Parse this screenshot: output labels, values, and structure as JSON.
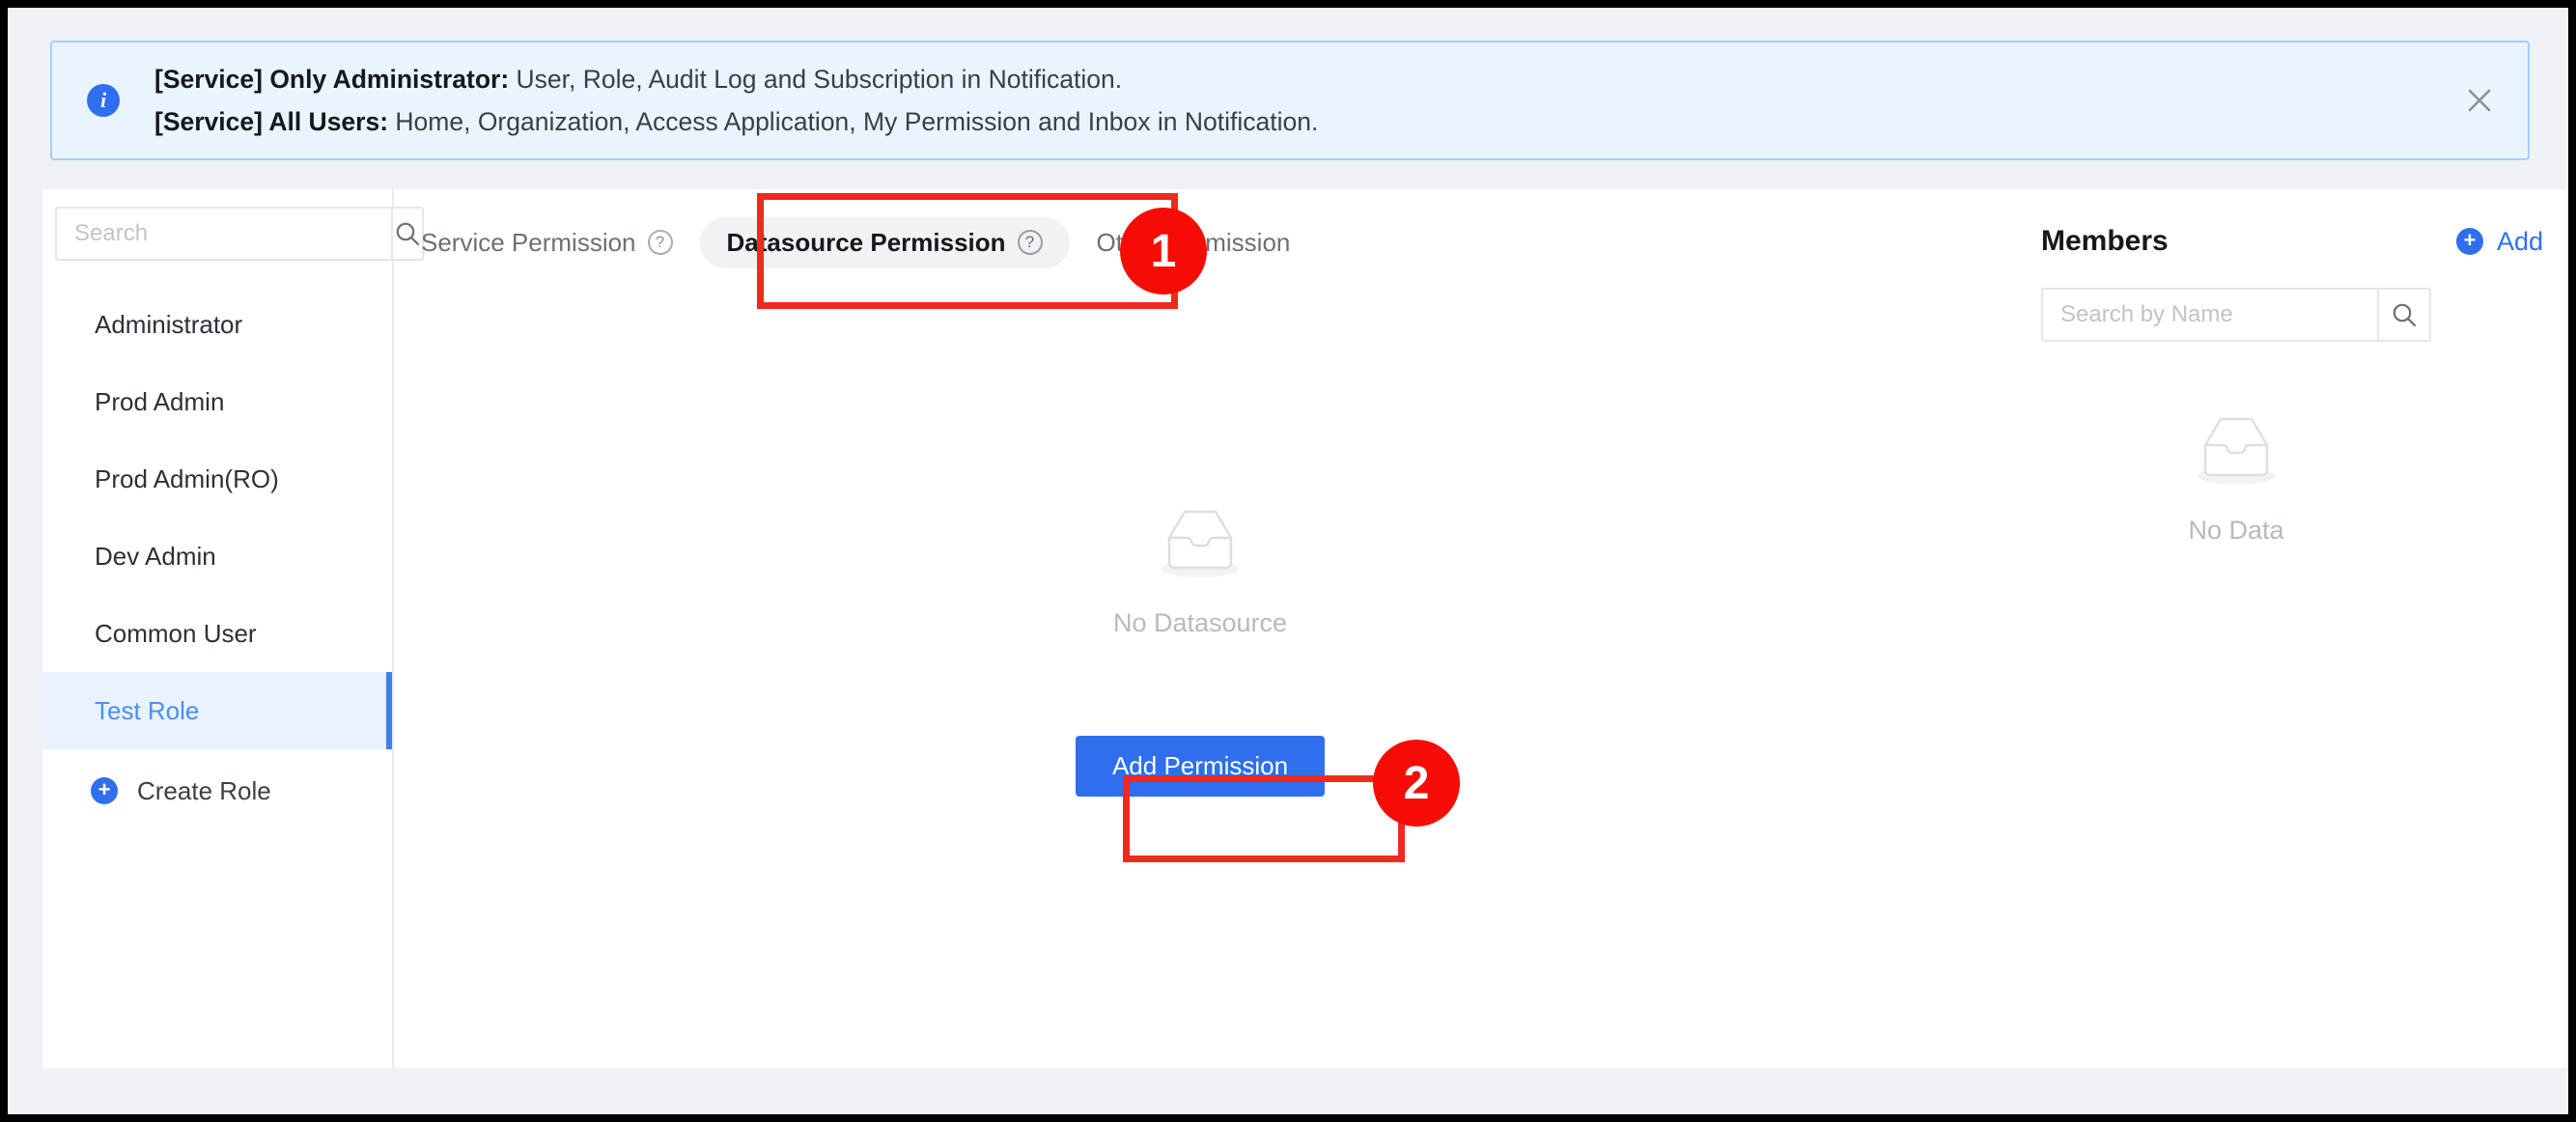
{
  "banner": {
    "icon": "info-icon",
    "line1_lead": "[Service] Only Administrator:",
    "line1_rest": " User, Role, Audit Log and Subscription in Notification.",
    "line2_lead": "[Service] All Users:",
    "line2_rest": " Home, Organization, Access Application, My Permission and Inbox in Notification.",
    "close_icon": "close-icon"
  },
  "sidebar": {
    "search": {
      "value": "",
      "placeholder": "Search",
      "icon": "search-icon"
    },
    "items": [
      {
        "label": "Administrator",
        "active": false
      },
      {
        "label": "Prod Admin",
        "active": false
      },
      {
        "label": "Prod Admin(RO)",
        "active": false
      },
      {
        "label": "Dev Admin",
        "active": false
      },
      {
        "label": "Common User",
        "active": false
      },
      {
        "label": "Test Role",
        "active": true
      }
    ],
    "create_role": {
      "label": "Create Role",
      "icon": "plus-circle-icon"
    }
  },
  "main": {
    "tabs": [
      {
        "label": "Service Permission",
        "help": "?",
        "active": false
      },
      {
        "label": "Datasource Permission",
        "help": "?",
        "active": true
      },
      {
        "label": "Other Permission",
        "help": "",
        "active": false
      }
    ],
    "empty": {
      "icon": "empty-tray-icon",
      "label": "No Datasource"
    },
    "add_permission_button": "Add Permission"
  },
  "members": {
    "title": "Members",
    "add_label": "Add",
    "add_icon": "plus-circle-icon",
    "search": {
      "value": "",
      "placeholder": "Search by Name",
      "icon": "search-icon"
    },
    "empty": {
      "icon": "empty-tray-icon",
      "label": "No Data"
    }
  },
  "annotations": [
    {
      "number": "1",
      "target": "datasource-permission-tab"
    },
    {
      "number": "2",
      "target": "add-permission-button"
    }
  ],
  "colors": {
    "accent": "#2f6fed",
    "annotation": "#f50d05",
    "banner_bg": "#e9f4ff",
    "banner_border": "#a3cffa",
    "active_item_bg": "#e9f2fe"
  }
}
